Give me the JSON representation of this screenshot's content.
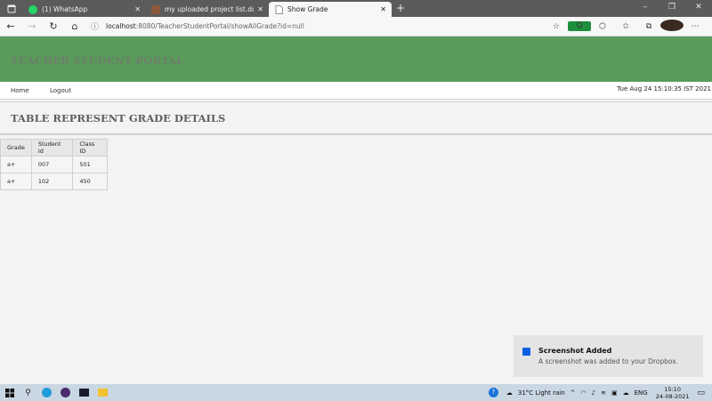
{
  "browser": {
    "tabs": [
      {
        "title": "(1) WhatsApp",
        "active": false
      },
      {
        "title": "my uploaded project list.downlo",
        "active": false
      },
      {
        "title": "Show Grade",
        "active": true
      }
    ],
    "url_host": "localhost",
    "url_path": ":8080/TeacherStudentPortal/showAllGrade?id=null"
  },
  "page": {
    "portal_title": "TEACHER STUDENT PORTAL",
    "nav": {
      "home": "Home",
      "logout": "Logout"
    },
    "datetime": "Tue Aug 24 15:10:35 IST 2021",
    "section_title": "TABLE REPRESENT GRADE DETAILS",
    "table": {
      "headers": [
        "Grade",
        "Student Id",
        "Class ID"
      ],
      "rows": [
        [
          "a+",
          "007",
          "501"
        ],
        [
          "a+",
          "102",
          "450"
        ]
      ]
    }
  },
  "toast": {
    "title": "Screenshot Added",
    "message": "A screenshot was added to your Dropbox."
  },
  "taskbar": {
    "weather": "31°C  Light rain",
    "language": "ENG",
    "time": "15:10",
    "date": "24-08-2021"
  },
  "colors": {
    "header_green": "#5a9a5a",
    "whatsapp_green": "#25d366",
    "dropbox_blue": "#0a62e0"
  }
}
